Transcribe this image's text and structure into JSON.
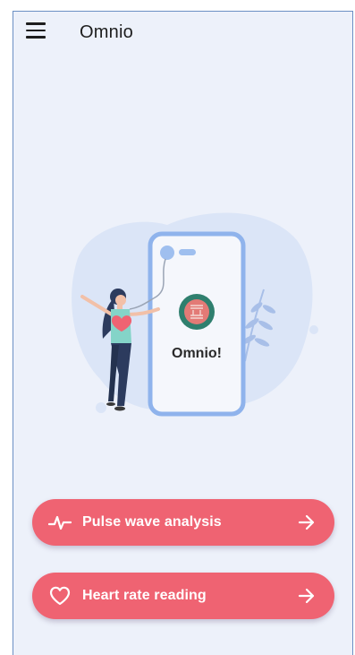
{
  "app_bar": {
    "title": "Omnio",
    "menu_icon": "hamburger-menu-icon"
  },
  "illustration": {
    "phone_screen_text": "Omnio!",
    "logo_icon": "omnio-logo-icon"
  },
  "actions": [
    {
      "label": "Pulse wave analysis",
      "icon": "pulse-wave-icon",
      "trailing_icon": "arrow-right-icon"
    },
    {
      "label": "Heart rate reading",
      "icon": "heart-outline-icon",
      "trailing_icon": "arrow-right-icon"
    }
  ],
  "colors": {
    "background": "#edf1fa",
    "button": "#ef6372",
    "phone_frame": "#8fb3ec",
    "logo_ring": "#2f7f6e"
  }
}
